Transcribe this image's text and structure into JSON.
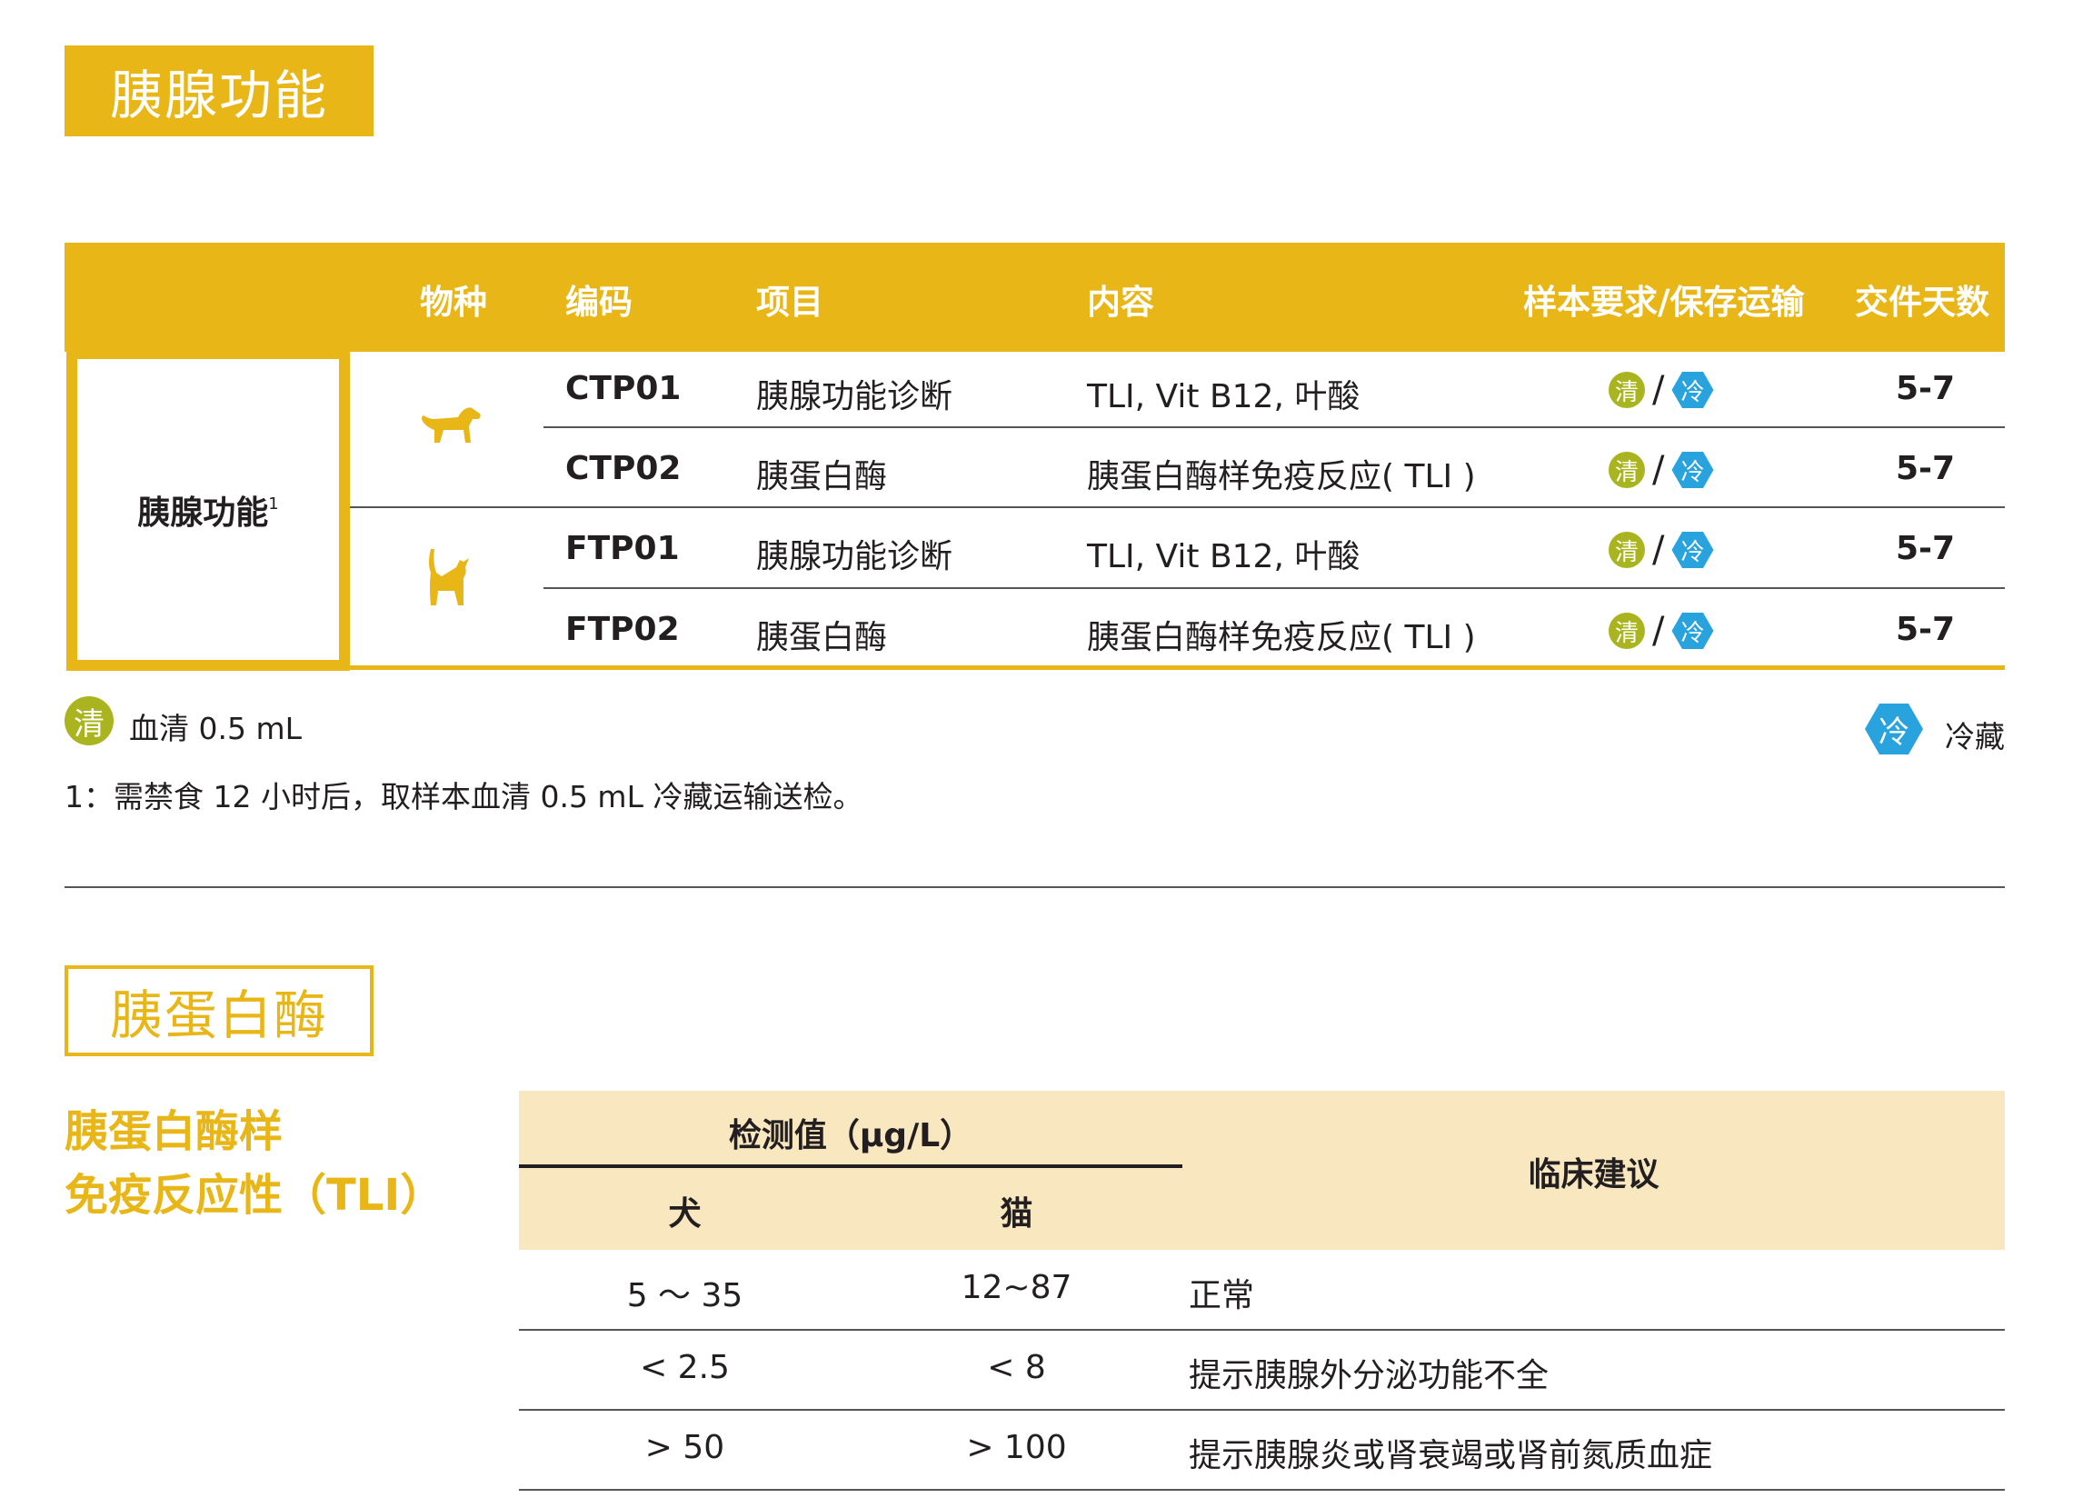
{
  "section1": {
    "title": "胰腺功能"
  },
  "table": {
    "headers": {
      "species": "物种",
      "code": "编码",
      "item": "项目",
      "content": "内容",
      "sample": "样本要求/保存运输",
      "days": "交件天数"
    },
    "category": {
      "label": "胰腺功能",
      "footnote_mark": "1"
    },
    "species": {
      "dog": "dog-icon",
      "cat": "cat-icon"
    },
    "rows": [
      {
        "code": "CTP01",
        "item": "胰腺功能诊断",
        "content": "TLI, Vit B12, 叶酸",
        "days": "5-7"
      },
      {
        "code": "CTP02",
        "item": "胰蛋白酶",
        "content": "胰蛋白酶样免疫反应( TLI )",
        "days": "5-7"
      },
      {
        "code": "FTP01",
        "item": "胰腺功能诊断",
        "content": "TLI, Vit B12, 叶酸",
        "days": "5-7"
      },
      {
        "code": "FTP02",
        "item": "胰蛋白酶",
        "content": "胰蛋白酶样免疫反应( TLI )",
        "days": "5-7"
      }
    ],
    "sample_icons": {
      "serum": "清",
      "slash": "/",
      "cold": "冷"
    }
  },
  "legend": {
    "serum_icon": "清",
    "serum_text": "血清 0.5 mL",
    "cold_icon": "冷",
    "cold_text": "冷藏",
    "footnote": "1：需禁食 12 小时后，取样本血清 0.5 mL 冷藏运输送检。"
  },
  "section2": {
    "title": "胰蛋白酶"
  },
  "tli": {
    "title_line1": "胰蛋白酶样",
    "title_line2": "免疫反应性（TLI）",
    "header_value": "检测值（μg/L）",
    "header_dog": "犬",
    "header_cat": "猫",
    "header_advice": "临床建议",
    "rows": [
      {
        "dog": "5 ～ 35",
        "cat": "12~87",
        "advice": "正常"
      },
      {
        "dog": "< 2.5",
        "cat": "< 8",
        "advice": "提示胰腺外分泌功能不全"
      },
      {
        "dog": "> 50",
        "cat": "> 100",
        "advice": "提示胰腺炎或肾衰竭或肾前氮质血症"
      }
    ]
  },
  "colors": {
    "gold": "#E8B617",
    "cream": "#F8E7BF",
    "serum_green": "#A9B41E",
    "cold_blue": "#29A3DD"
  }
}
